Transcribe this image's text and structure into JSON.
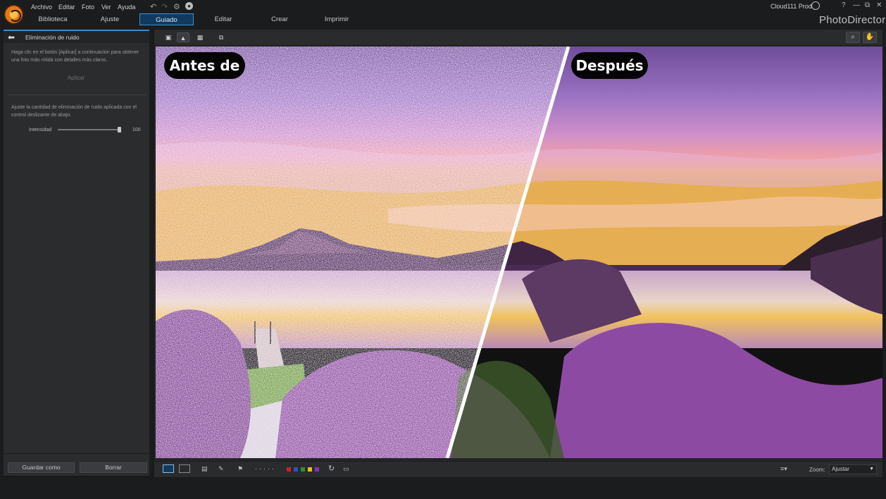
{
  "menu": [
    "Archivo",
    "Editar",
    "Foto",
    "Ver",
    "Ayuda"
  ],
  "modes": [
    "Biblioteca",
    "Ajuste",
    "Guiado",
    "Editar",
    "Crear",
    "Imprimir"
  ],
  "active_mode": "Guiado",
  "user": "Cloud111 Prod",
  "app_name": "PhotoDirector",
  "window_buttons": [
    "?",
    "—",
    "⧉",
    "✕"
  ],
  "panel": {
    "title": "Eliminación de ruido",
    "desc1": "Haga clic en el botón [Aplicar] a continuación para obtener una foto más nítida con detalles más claros.",
    "apply": "Aplicar",
    "desc2": "Ajuste la cantidad de eliminación de ruido aplicada con el control deslizante de abajo.",
    "intensity_label": "Intensidad",
    "intensity_value": "100",
    "intensity_fraction": 1.0,
    "save_as": "Guardar como",
    "delete": "Borrar"
  },
  "viewer": {
    "before_label": "Antes de",
    "after_label": "Después"
  },
  "zoom": {
    "label": "Zoom:",
    "value": "Ajustar"
  },
  "color_labels": [
    "#d02020",
    "#2a55c8",
    "#2f8f3a",
    "#e0c21a",
    "#8e2fb8"
  ],
  "colors": {
    "accent": "#3a8cd1",
    "panel_bg": "#2b2c2e",
    "app_bg": "#1b1c1e"
  }
}
